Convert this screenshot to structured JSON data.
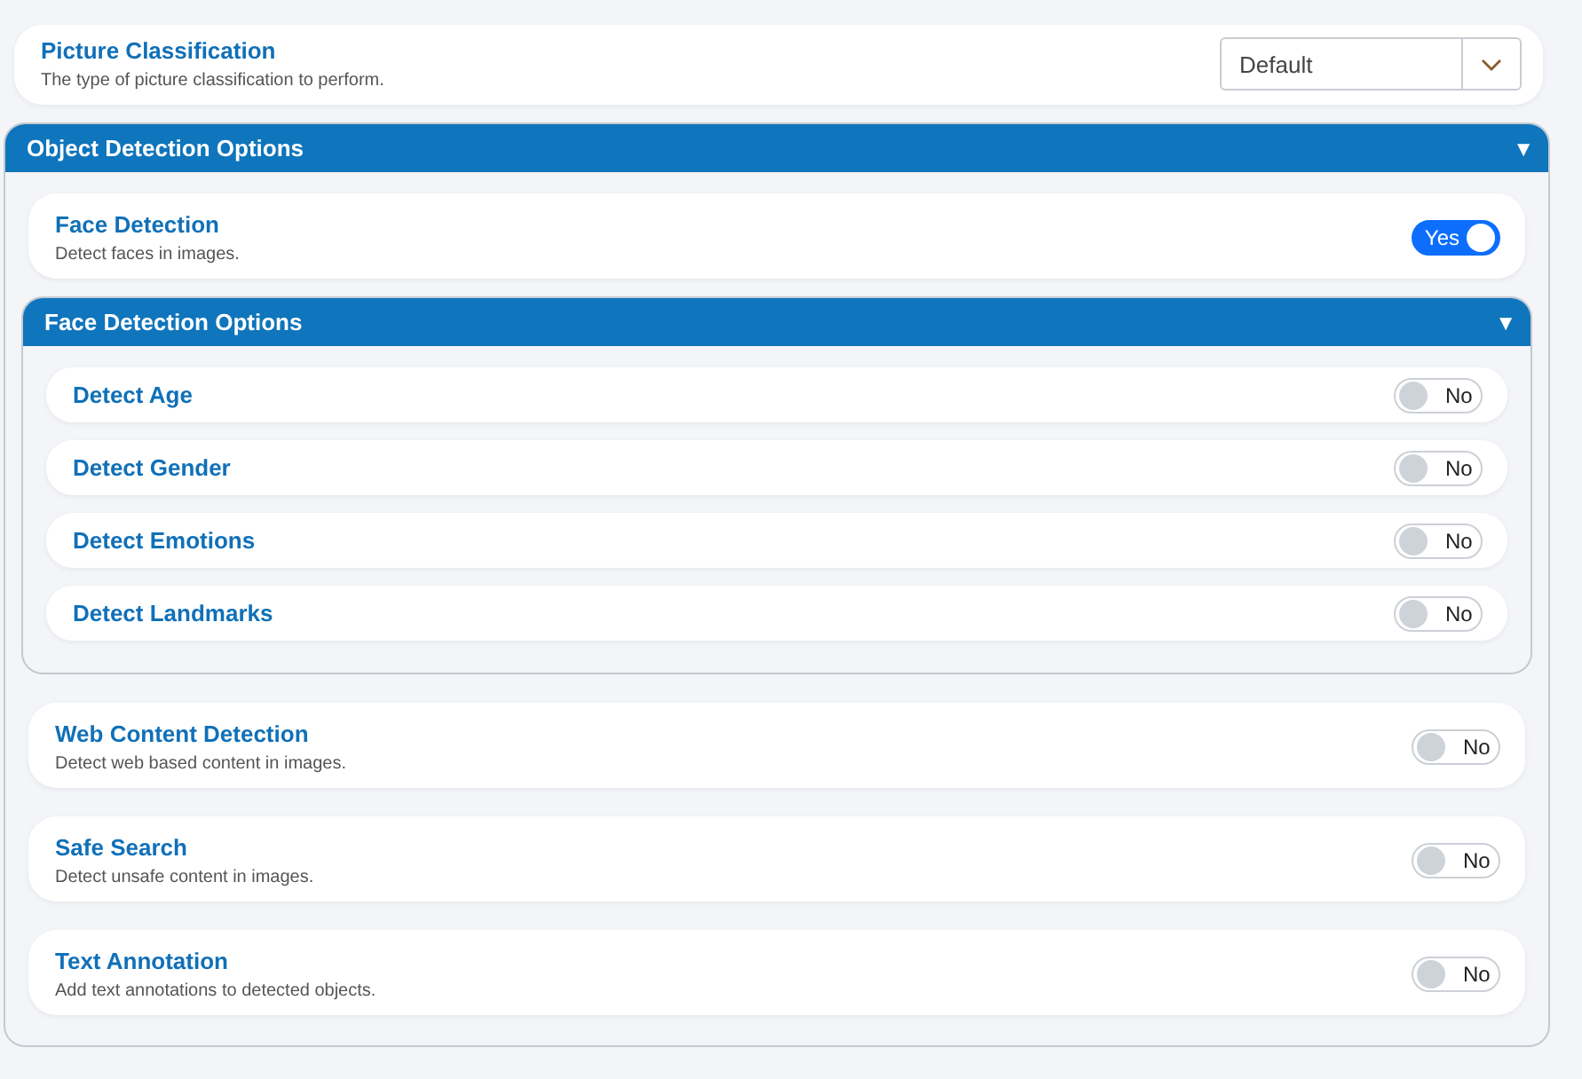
{
  "classification": {
    "title": "Picture Classification",
    "description": "The type of picture classification to perform.",
    "select": {
      "value": "Default"
    }
  },
  "section": {
    "title": "Object Detection Options",
    "marker": "▼",
    "items": [
      {
        "kind": "setting",
        "title": "Face Detection",
        "description": "Detect faces in images.",
        "toggle": {
          "on": true,
          "label": "Yes"
        }
      },
      {
        "kind": "group",
        "title": "Face Detection Options",
        "marker": "▼",
        "items": [
          {
            "title": "Detect Age",
            "toggle": {
              "on": false,
              "label": "No"
            }
          },
          {
            "title": "Detect Gender",
            "toggle": {
              "on": false,
              "label": "No"
            }
          },
          {
            "title": "Detect Emotions",
            "toggle": {
              "on": false,
              "label": "No"
            }
          },
          {
            "title": "Detect Landmarks",
            "toggle": {
              "on": false,
              "label": "No"
            }
          }
        ]
      },
      {
        "kind": "setting",
        "title": "Web Content Detection",
        "description": "Detect web based content in images.",
        "toggle": {
          "on": false,
          "label": "No"
        }
      },
      {
        "kind": "setting",
        "title": "Safe Search",
        "description": "Detect unsafe content in images.",
        "toggle": {
          "on": false,
          "label": "No"
        }
      },
      {
        "kind": "setting",
        "title": "Text Annotation",
        "description": "Add text annotations to detected objects.",
        "toggle": {
          "on": false,
          "label": "No"
        }
      }
    ]
  }
}
